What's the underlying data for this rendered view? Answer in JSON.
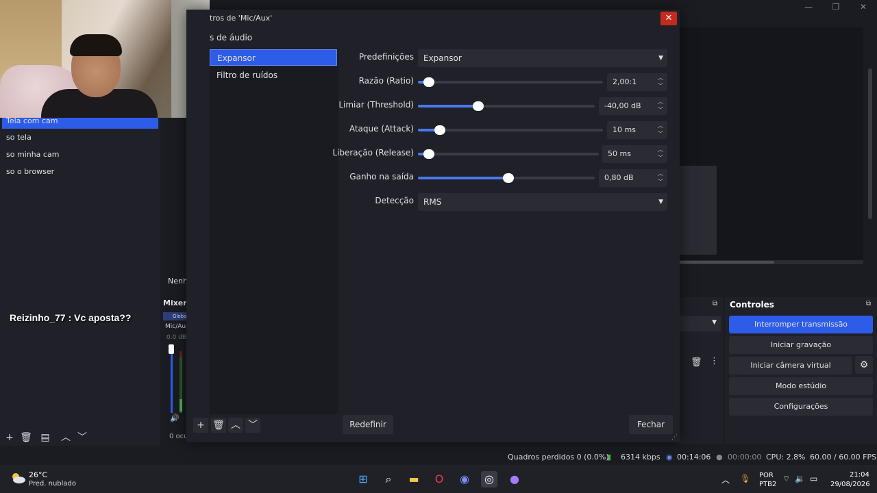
{
  "main_window": {
    "scenes": [
      {
        "label": "Tela com cam",
        "selected": true
      },
      {
        "label": "so tela"
      },
      {
        "label": "so minha cam"
      },
      {
        "label": "so o browser"
      }
    ],
    "chat_message": "Reizinho_77 : Vc aposta??",
    "sources_empty_label": "Nenh",
    "mixer_header": "Mixer",
    "mixer_global_label": "Globa",
    "mixer_track": "Mic/Aux",
    "mixer_db": "0.0 dB",
    "mixer_footer": "0 ocu",
    "controls_title": "Controles",
    "controls": {
      "stop_stream": "Interromper transmissão",
      "start_recording": "Iniciar gravação",
      "start_virtual_cam": "Iniciar câmera virtual",
      "studio_mode": "Modo estúdio",
      "settings": "Configurações"
    },
    "status": {
      "dropped_frames": "Quadros perdidos 0 (0.0%)",
      "bitrate": "6314 kbps",
      "stream_time": "00:14:06",
      "record_time": "00:00:00",
      "cpu": "CPU: 2.8%",
      "fps": "60.00 / 60.00 FPS"
    }
  },
  "dialog": {
    "title": "tros de 'Mic/Aux'",
    "filter_list_header": "s de áudio",
    "filters": [
      {
        "label": "Expansor",
        "selected": true
      },
      {
        "label": "Filtro de ruídos"
      }
    ],
    "properties": {
      "preset_label": "Predefinições",
      "preset_value": "Expansor",
      "ratio_label": "Razão (Ratio)",
      "ratio_value": "2,00:1",
      "threshold_label": "Limiar (Threshold)",
      "threshold_value": "-40,00 dB",
      "attack_label": "Ataque (Attack)",
      "attack_value": "10 ms",
      "release_label": "Liberação (Release)",
      "release_value": "50 ms",
      "gain_label": "Ganho na saída",
      "gain_value": "0,80 dB",
      "detection_label": "Detecção",
      "detection_value": "RMS"
    },
    "slider_levels": {
      "ratio": 0.06,
      "threshold": 0.34,
      "attack": 0.12,
      "release": 0.06,
      "gain": 0.51
    },
    "reset_button": "Redefinir",
    "close_button": "Fechar"
  },
  "taskbar": {
    "temperature": "26°C",
    "weather": "Pred. nublado",
    "lang_line1": "POR",
    "lang_line2": "PTB2",
    "time": "21:04",
    "date": "29/08/2026"
  },
  "colors": {
    "accent": "#2d5ce8",
    "close_red": "#c42b1c",
    "slider_fill": "#4a78f0"
  }
}
